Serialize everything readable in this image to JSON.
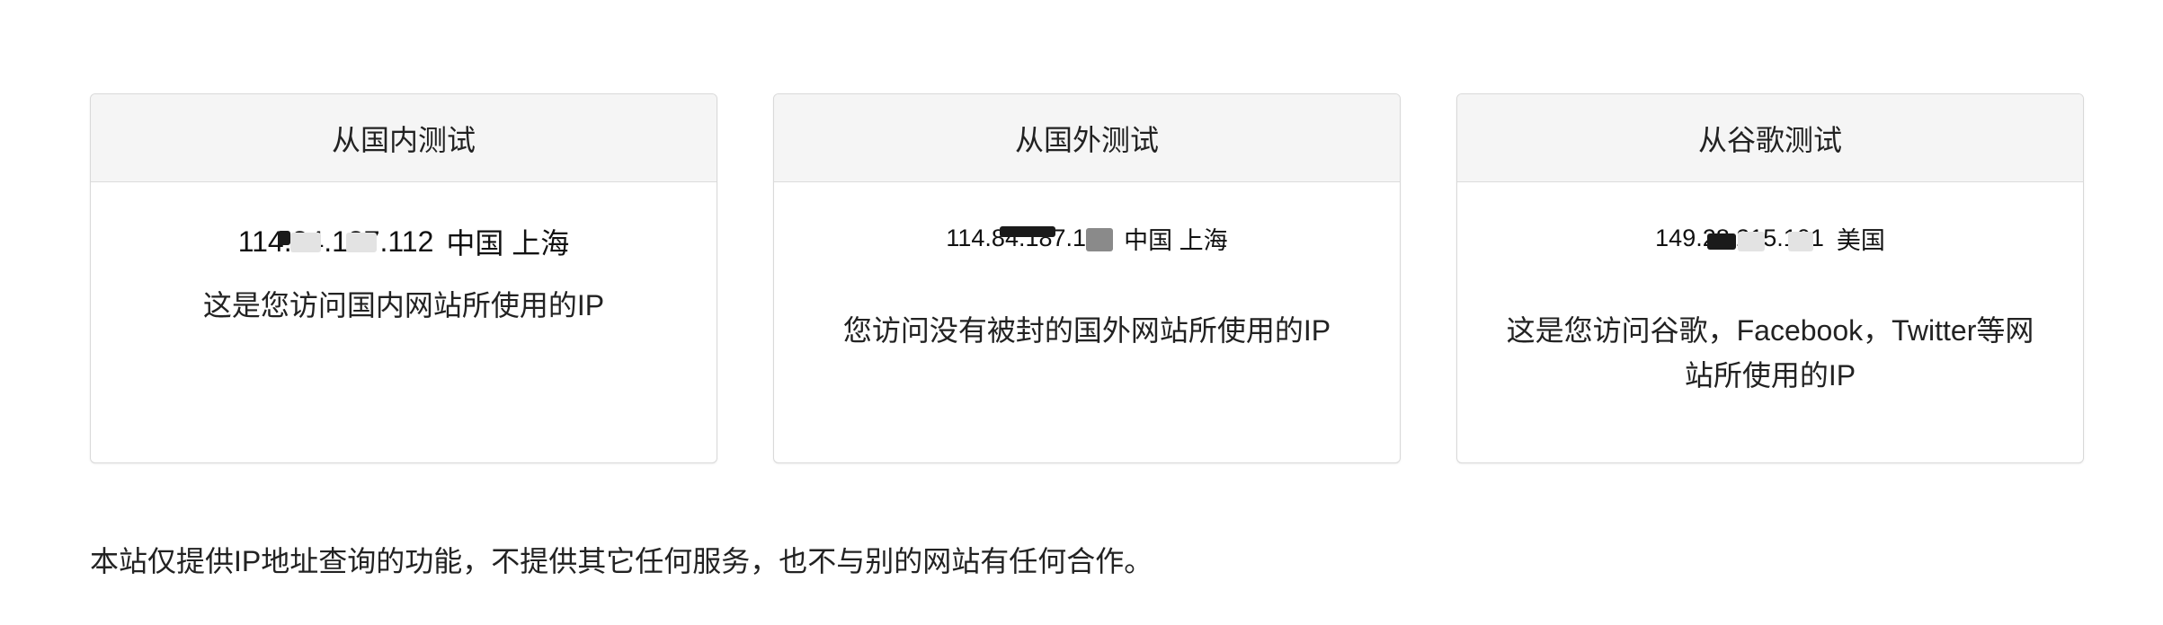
{
  "cards": [
    {
      "title": "从国内测试",
      "ip": "114.84.187.112",
      "location": "中国 上海",
      "description": "这是您访问国内网站所使用的IP"
    },
    {
      "title": "从国外测试",
      "ip": "114.84.187.112",
      "location": "中国 上海",
      "description": "您访问没有被封的国外网站所使用的IP"
    },
    {
      "title": "从谷歌测试",
      "ip": "149.28.215.101",
      "location": "美国",
      "description": "这是您访问谷歌，Facebook，Twitter等网站所使用的IP"
    }
  ],
  "footer": {
    "text": "本站仅提供IP地址查询的功能，不提供其它任何服务，也不与别的网站有任何合作。"
  },
  "colors": {
    "header_bg": "#f5f5f5",
    "border": "#d9d9d9",
    "text": "#222222"
  }
}
